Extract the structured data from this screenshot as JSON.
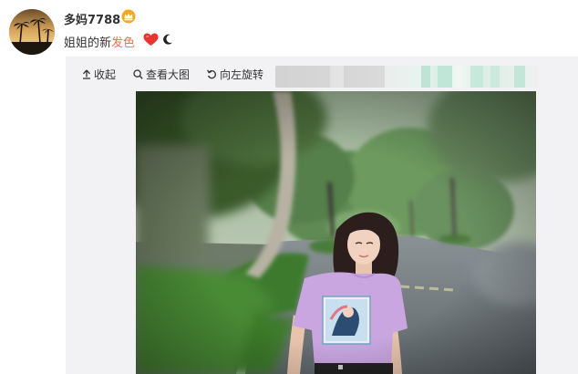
{
  "user": {
    "name": "多妈7788"
  },
  "post": {
    "text_before": "姐姐的新",
    "text_highlight": "发色"
  },
  "toolbar": {
    "collapse_label": "收起",
    "zoom_label": "查看大图",
    "rotate_label": "向左旋转"
  },
  "icons": {
    "vip": "crown-badge-icon",
    "heart": "red-heart-emoji",
    "moon": "crescent-moon-emoji",
    "collapse": "arrow-up-icon",
    "zoom": "magnifier-icon",
    "rotate": "rotate-left-icon"
  },
  "colors": {
    "highlight": "#eb7350",
    "heart": "#e8352f",
    "media_background": "#f2f2f5",
    "shirt": "#c9a6e0"
  }
}
